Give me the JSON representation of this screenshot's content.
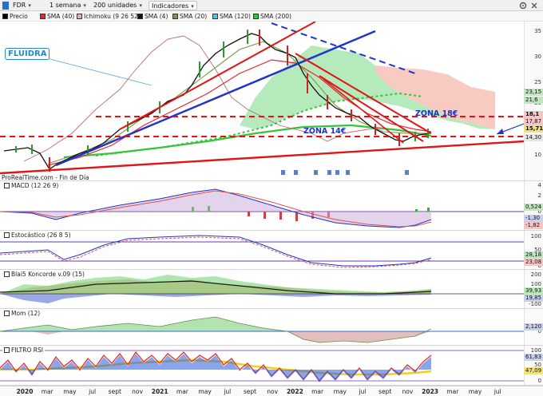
{
  "toolbar": {
    "symbol": "FDR",
    "period": "1 semana",
    "units": "200 unidades",
    "indicators_button": "Indicadores"
  },
  "legend": {
    "items": [
      {
        "label": "Precio",
        "color": "#000000"
      },
      {
        "label": "SMA (40)",
        "color": "#e4262d"
      },
      {
        "label": "Ichimoku (9 26 52)",
        "color": "#e3b0b0"
      },
      {
        "label": "SMA (4)",
        "color": "#111111"
      },
      {
        "label": "SMA (20)",
        "color": "#7a9a4a"
      },
      {
        "label": "SMA (120)",
        "color": "#58c0e8"
      },
      {
        "label": "SMA (200)",
        "color": "#3ac23a"
      }
    ]
  },
  "main": {
    "source": "ProRealTime.com - Fin de Día",
    "annotations": {
      "fluidra": "FLUIDRA",
      "zona18": "ZONA 18€",
      "zona14": "ZONA 14€"
    },
    "y_ticks": [
      "35",
      "30",
      "25",
      "20",
      "15",
      "10"
    ],
    "price_tags": [
      "23,15",
      "21,6",
      "18,1",
      "17,87",
      "15,71",
      "14,30"
    ]
  },
  "panels": {
    "macd": {
      "title": "MACD (12 26 9)",
      "ticks": [
        "4",
        "2",
        "0",
        "-2"
      ],
      "tags": [
        "0,524",
        "-1,30",
        "-1,82"
      ]
    },
    "stoch": {
      "title": "Estocástico (26 8 5)",
      "ticks": [
        "100",
        "50",
        "0"
      ],
      "tags": [
        "28,18",
        "23,08"
      ]
    },
    "blai5": {
      "title": "Blai5 Koncorde v.09 (15)",
      "ticks": [
        "200",
        "100",
        "0",
        "-100"
      ],
      "tags": [
        "39,93",
        "19,85"
      ]
    },
    "mom": {
      "title": "Mom (12)",
      "ticks": [
        "0"
      ],
      "tags": [
        "2,120"
      ]
    },
    "rsi": {
      "title": "FILTRO RSI",
      "ticks": [
        "100",
        "50",
        "0"
      ],
      "tags": [
        "61,83",
        "47,09"
      ]
    }
  },
  "x_axis": {
    "labels": [
      {
        "text": "2020",
        "year": true
      },
      {
        "text": "mar",
        "year": false
      },
      {
        "text": "may",
        "year": false
      },
      {
        "text": "jul",
        "year": false
      },
      {
        "text": "sept",
        "year": false
      },
      {
        "text": "nov",
        "year": false
      },
      {
        "text": "2021",
        "year": true
      },
      {
        "text": "mar",
        "year": false
      },
      {
        "text": "may",
        "year": false
      },
      {
        "text": "jul",
        "year": false
      },
      {
        "text": "sept",
        "year": false
      },
      {
        "text": "nov",
        "year": false
      },
      {
        "text": "2022",
        "year": true
      },
      {
        "text": "mar",
        "year": false
      },
      {
        "text": "may",
        "year": false
      },
      {
        "text": "jul",
        "year": false
      },
      {
        "text": "sept",
        "year": false
      },
      {
        "text": "nov",
        "year": false
      },
      {
        "text": "2023",
        "year": true
      },
      {
        "text": "mar",
        "year": false
      },
      {
        "text": "may",
        "year": false
      },
      {
        "text": "jul",
        "year": false
      }
    ]
  },
  "colors": {
    "candle_up": "#2d9a2d",
    "candle_down": "#d02020",
    "trend_blue": "#1f35c8",
    "trend_red": "#e01515",
    "cloud_green": "#a8e6b0",
    "cloud_red": "#f6c5bb",
    "sma200": "#3ac23a",
    "ichimoku_lag": "#b47070"
  },
  "chart_data": [
    {
      "type": "line",
      "name": "price",
      "x_start": "2020-01",
      "x_end": "2023-07",
      "x": [
        "2020-01",
        "2020-03",
        "2020-05",
        "2020-07",
        "2020-09",
        "2020-11",
        "2021-01",
        "2021-03",
        "2021-05",
        "2021-07",
        "2021-09",
        "2021-11",
        "2022-01",
        "2022-03",
        "2022-05",
        "2022-07",
        "2022-09",
        "2022-11",
        "2022-12"
      ],
      "series": [
        {
          "values": [
            13.0,
            10.5,
            11.5,
            13.0,
            14.0,
            17.0,
            19.5,
            22.0,
            28.0,
            31.0,
            34.5,
            32.0,
            29.0,
            24.0,
            21.0,
            19.0,
            15.5,
            14.0,
            15.7
          ]
        }
      ],
      "ylim": [
        9,
        37
      ]
    }
  ]
}
